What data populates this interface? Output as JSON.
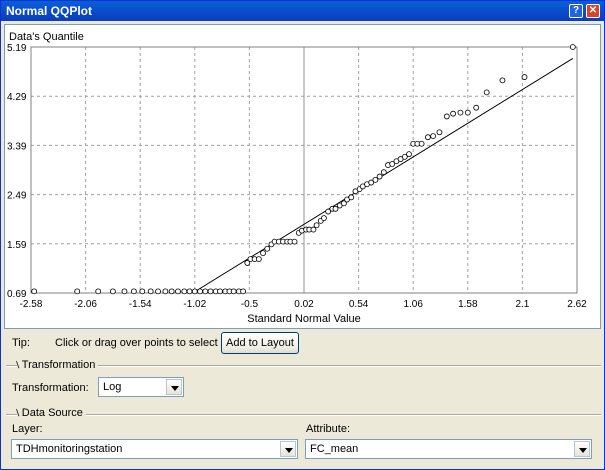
{
  "window": {
    "title": "Normal QQPlot",
    "help_glyph": "?",
    "close_glyph": "✕"
  },
  "chart_data": {
    "type": "scatter",
    "ylabel": "Data's Quantile",
    "xlabel": "Standard Normal Value",
    "x_ticks": [
      "-2.58",
      "-2.06",
      "-1.54",
      "-1.02",
      "-0.5",
      "0.02",
      "0.54",
      "1.06",
      "1.58",
      "2.1",
      "2.62"
    ],
    "y_ticks": [
      "0.69",
      "1.59",
      "2.49",
      "3.39",
      "4.29",
      "5.19"
    ],
    "xlim": [
      -2.58,
      2.62
    ],
    "ylim": [
      0.69,
      5.19
    ],
    "grid": true,
    "reference_line": {
      "x": [
        -1.04,
        2.58
      ],
      "y": [
        0.69,
        4.98
      ]
    },
    "points": [
      [
        -2.55,
        0.72
      ],
      [
        -2.14,
        0.72
      ],
      [
        -1.94,
        0.72
      ],
      [
        -1.8,
        0.72
      ],
      [
        -1.69,
        0.72
      ],
      [
        -1.6,
        0.72
      ],
      [
        -1.52,
        0.72
      ],
      [
        -1.44,
        0.72
      ],
      [
        -1.37,
        0.72
      ],
      [
        -1.3,
        0.72
      ],
      [
        -1.24,
        0.72
      ],
      [
        -1.18,
        0.72
      ],
      [
        -1.12,
        0.72
      ],
      [
        -1.07,
        0.72
      ],
      [
        -1.02,
        0.72
      ],
      [
        -0.97,
        0.72
      ],
      [
        -0.92,
        0.72
      ],
      [
        -0.87,
        0.72
      ],
      [
        -0.82,
        0.72
      ],
      [
        -0.78,
        0.72
      ],
      [
        -0.73,
        0.72
      ],
      [
        -0.69,
        0.72
      ],
      [
        -0.65,
        0.72
      ],
      [
        -0.6,
        0.72
      ],
      [
        -0.56,
        0.72
      ],
      [
        -0.52,
        1.24
      ],
      [
        -0.49,
        1.31
      ],
      [
        -0.45,
        1.31
      ],
      [
        -0.41,
        1.31
      ],
      [
        -0.37,
        1.42
      ],
      [
        -0.33,
        1.5
      ],
      [
        -0.29,
        1.58
      ],
      [
        -0.26,
        1.63
      ],
      [
        -0.22,
        1.63
      ],
      [
        -0.18,
        1.63
      ],
      [
        -0.14,
        1.63
      ],
      [
        -0.11,
        1.63
      ],
      [
        -0.07,
        1.63
      ],
      [
        -0.03,
        1.79
      ],
      [
        0.0,
        1.83
      ],
      [
        0.04,
        1.85
      ],
      [
        0.07,
        1.85
      ],
      [
        0.11,
        1.85
      ],
      [
        0.14,
        1.93
      ],
      [
        0.18,
        2.01
      ],
      [
        0.21,
        2.06
      ],
      [
        0.25,
        2.18
      ],
      [
        0.29,
        2.23
      ],
      [
        0.32,
        2.23
      ],
      [
        0.36,
        2.29
      ],
      [
        0.4,
        2.33
      ],
      [
        0.43,
        2.4
      ],
      [
        0.47,
        2.44
      ],
      [
        0.51,
        2.55
      ],
      [
        0.55,
        2.59
      ],
      [
        0.58,
        2.64
      ],
      [
        0.62,
        2.68
      ],
      [
        0.66,
        2.71
      ],
      [
        0.7,
        2.76
      ],
      [
        0.74,
        2.82
      ],
      [
        0.78,
        2.9
      ],
      [
        0.82,
        3.03
      ],
      [
        0.86,
        3.05
      ],
      [
        0.9,
        3.1
      ],
      [
        0.94,
        3.14
      ],
      [
        0.98,
        3.18
      ],
      [
        1.02,
        3.23
      ],
      [
        1.06,
        3.42
      ],
      [
        1.1,
        3.42
      ],
      [
        1.14,
        3.42
      ],
      [
        1.2,
        3.54
      ],
      [
        1.25,
        3.56
      ],
      [
        1.31,
        3.63
      ],
      [
        1.38,
        3.92
      ],
      [
        1.44,
        3.97
      ],
      [
        1.51,
        3.99
      ],
      [
        1.58,
        3.99
      ],
      [
        1.66,
        4.08
      ],
      [
        1.76,
        4.36
      ],
      [
        1.91,
        4.58
      ],
      [
        2.12,
        4.64
      ],
      [
        2.58,
        5.19
      ]
    ]
  },
  "tip": {
    "label": "Tip:",
    "message": "Click or drag over points to select"
  },
  "add_to_layout_label": "Add to Layout",
  "transformation_group": {
    "title": "Transformation",
    "field_label": "Transformation:",
    "selected": "Log"
  },
  "data_source_group": {
    "title": "Data Source",
    "layer_label": "Layer:",
    "layer_value": "TDHmonitoringstation",
    "attribute_label": "Attribute:",
    "attribute_value": "FC_mean"
  }
}
